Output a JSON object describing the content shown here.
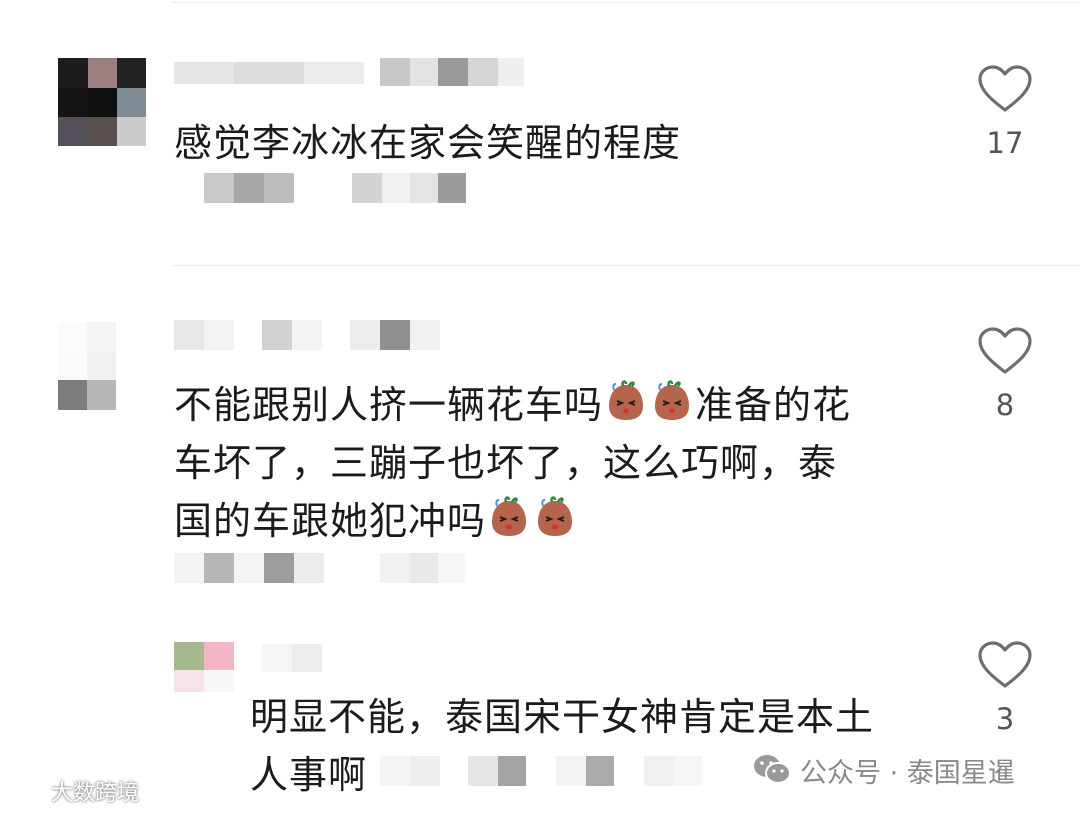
{
  "comments": [
    {
      "text": "感觉李冰冰在家会笑醒的程度",
      "like_count": "17"
    },
    {
      "text_line1": "不能跟别人挤一辆花车吗",
      "text_line1b": "准备的花",
      "text_line2": "车坏了，三蹦子也坏了，这么巧啊，泰",
      "text_line3": "国的车跟她犯冲吗",
      "like_count": "8"
    },
    {
      "text_line1": "明显不能，泰国宋干女神肯定是本土",
      "text_line2": "人事啊",
      "like_count": "3"
    }
  ],
  "watermarks": {
    "left": "大数跨境",
    "right": "公众号 · 泰国星暹"
  },
  "icons": {
    "like": "heart-outline-icon",
    "emoji": "sweating-potato-emoji",
    "wechat": "wechat-icon"
  },
  "colors": {
    "text": "#1b1b1b",
    "like_icon": "#6e6e6e",
    "divider": "#ececec",
    "watermark": "#8a8a8a"
  }
}
